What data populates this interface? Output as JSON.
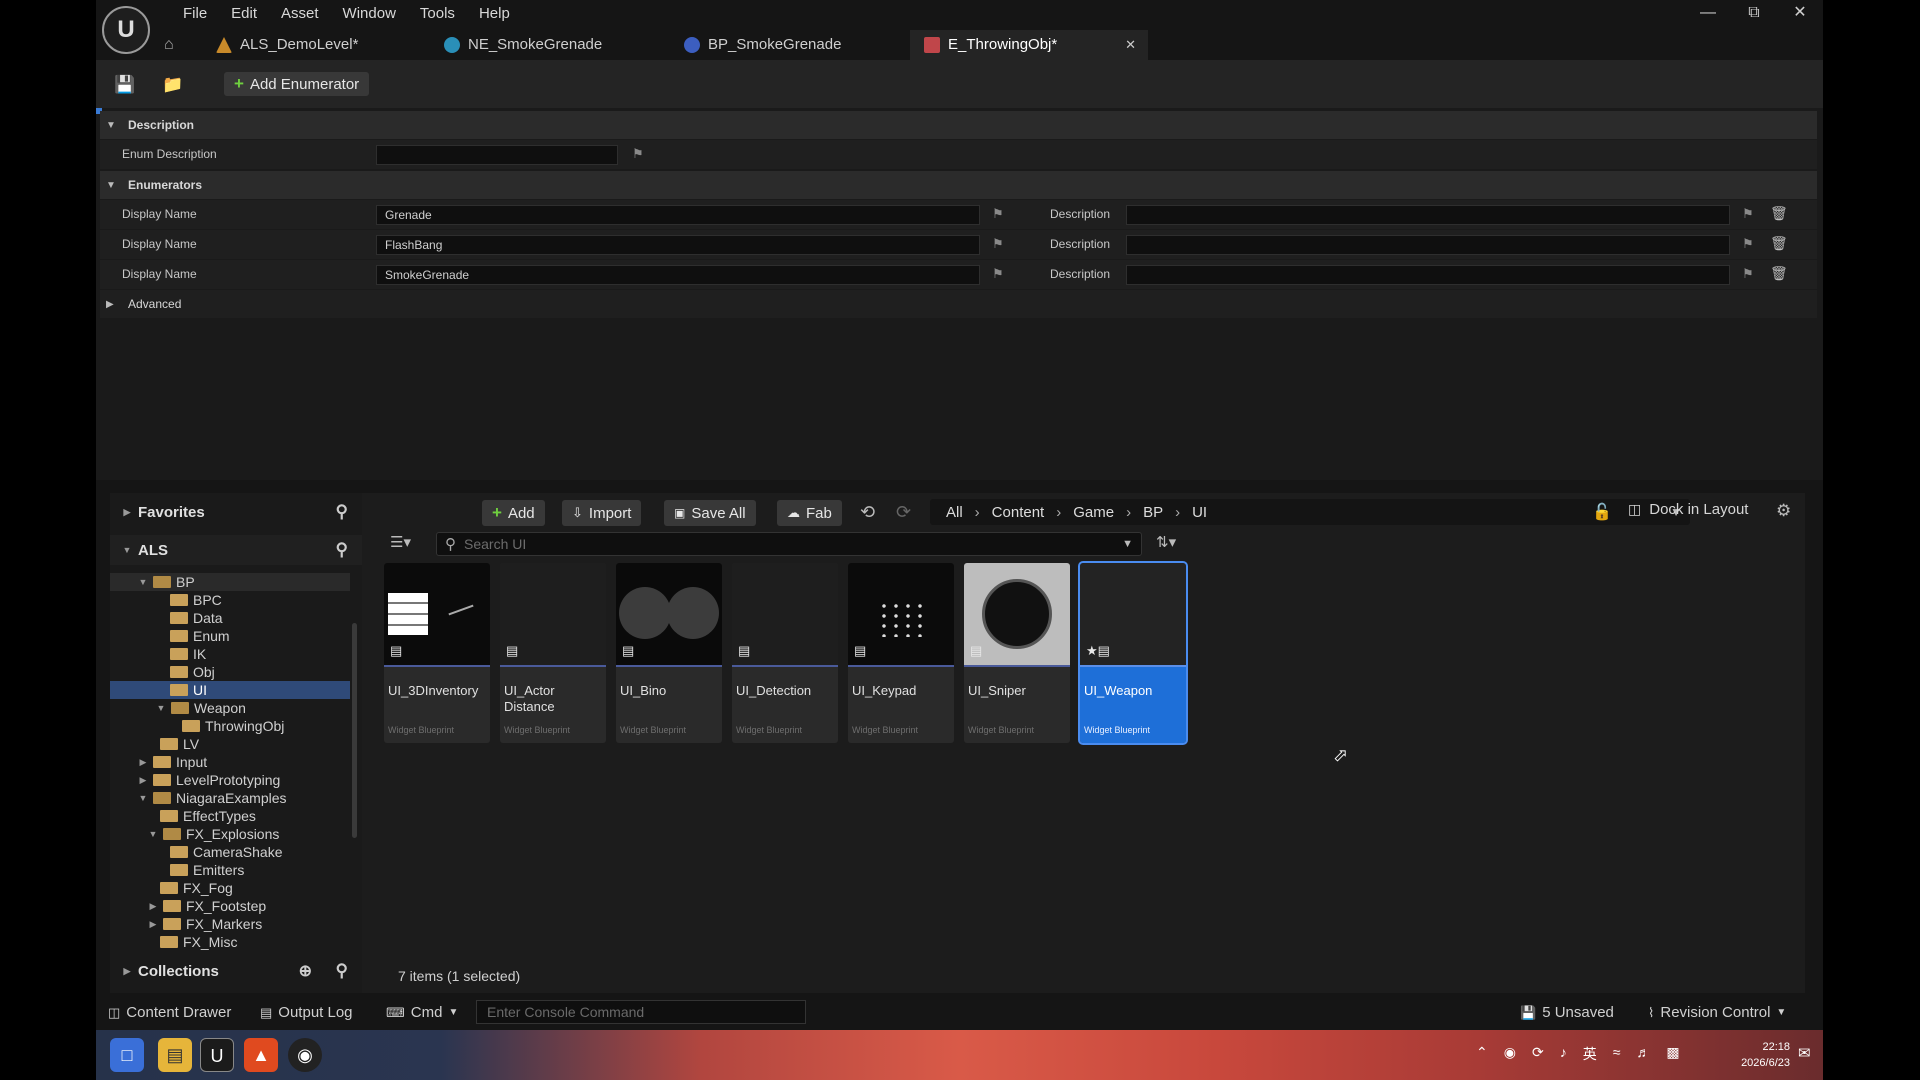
{
  "menu": [
    "File",
    "Edit",
    "Asset",
    "Window",
    "Tools",
    "Help"
  ],
  "tabs": [
    {
      "label": "ALS_DemoLevel*"
    },
    {
      "label": "NE_SmokeGrenade"
    },
    {
      "label": "BP_SmokeGrenade"
    },
    {
      "label": "E_ThrowingObj*"
    }
  ],
  "toolbar": {
    "add_enumerator": "Add Enumerator"
  },
  "details": {
    "description_header": "Description",
    "enum_description_label": "Enum Description",
    "enum_description_value": "",
    "enumerators_header": "Enumerators",
    "enumerators": [
      {
        "label": "Display Name",
        "value": "Grenade",
        "desc_label": "Description",
        "desc_value": ""
      },
      {
        "label": "Display Name",
        "value": "FlashBang",
        "desc_label": "Description",
        "desc_value": ""
      },
      {
        "label": "Display Name",
        "value": "SmokeGrenade",
        "desc_label": "Description",
        "desc_value": ""
      }
    ],
    "advanced_header": "Advanced"
  },
  "content_browser": {
    "favorites": "Favorites",
    "project": "ALS",
    "collections": "Collections",
    "toolbar": {
      "add": "Add",
      "import": "Import",
      "save_all": "Save All",
      "fab": "Fab",
      "dock": "Dock in Layout"
    },
    "breadcrumb": [
      "All",
      "Content",
      "Game",
      "BP",
      "UI"
    ],
    "search_placeholder": "Search UI",
    "tree": [
      "BP",
      "BPC",
      "Data",
      "Enum",
      "IK",
      "Obj",
      "UI",
      "Weapon",
      "ThrowingObj",
      "LV",
      "Input",
      "LevelPrototyping",
      "NiagaraExamples",
      "EffectTypes",
      "FX_Explosions",
      "CameraShake",
      "Emitters",
      "FX_Fog",
      "FX_Footstep",
      "FX_Markers",
      "FX_Misc"
    ],
    "assets": [
      {
        "name": "UI_3DInventory",
        "type": "Widget Blueprint"
      },
      {
        "name": "UI_Actor Distance",
        "type": "Widget Blueprint"
      },
      {
        "name": "UI_Bino",
        "type": "Widget Blueprint"
      },
      {
        "name": "UI_Detection",
        "type": "Widget Blueprint"
      },
      {
        "name": "UI_Keypad",
        "type": "Widget Blueprint"
      },
      {
        "name": "UI_Sniper",
        "type": "Widget Blueprint"
      },
      {
        "name": "UI_Weapon",
        "type": "Widget Blueprint"
      }
    ],
    "item_count": "7 items (1 selected)"
  },
  "statusbar": {
    "content_drawer": "Content Drawer",
    "output_log": "Output Log",
    "cmd": "Cmd",
    "console_placeholder": "Enter Console Command",
    "unsaved": "5 Unsaved",
    "revision_control": "Revision Control"
  },
  "taskbar": {
    "time": "22:18",
    "date": "2026/6/23",
    "ime": "英"
  }
}
